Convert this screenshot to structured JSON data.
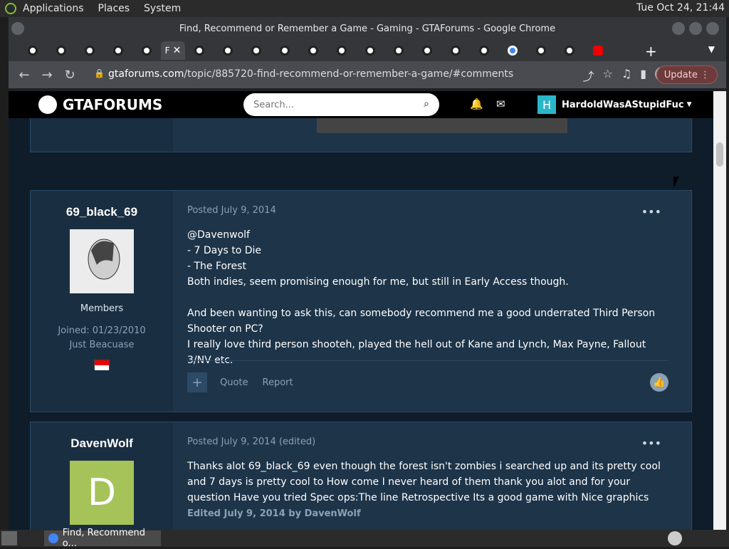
{
  "os_bar": {
    "menus": [
      "Applications",
      "Places",
      "System"
    ],
    "clock": "Tue Oct 24, 21:44"
  },
  "window": {
    "title": "Find, Recommend or Remember a Game - Gaming - GTAForums - Google Chrome"
  },
  "tabs": {
    "active_label": "F",
    "count": 22
  },
  "address": {
    "host": "gtaforums.com",
    "path": "/topic/885720-find-recommend-or-remember-a-game/#comments",
    "update_label": "Update"
  },
  "site": {
    "logo_text": "GTAFORUMS",
    "search_placeholder": "Search...",
    "username": "HardoldWasAStupidFuc",
    "user_initial": "H"
  },
  "posts": [
    {
      "author": "69_black_69",
      "role": "Members",
      "joined": "Joined: 01/23/2010",
      "location": "Just Beacuase",
      "date": "Posted July 9, 2014",
      "body_lines": [
        "@Davenwolf",
        "- 7 Days to Die",
        "- The Forest",
        "Both indies, seem promising enough for me, but still in Early Access though.",
        "",
        "And been wanting to ask this, can somebody recommend me a good underrated Third Person Shooter on PC?",
        "I really love third person shooteh, played the hell out of Kane and Lynch, Max Payne, Fallout 3/NV etc."
      ],
      "actions": [
        "Quote",
        "Report"
      ]
    },
    {
      "author": "DavenWolf",
      "avatar_initial": "D",
      "date": "Posted July 9, 2014 (edited)",
      "body": "Thanks alot 69_black_69 even though the forest isn't zombies i searched up and its pretty cool and 7 days is pretty cool to How come I never heard of them thank you alot and for your question Have you tried Spec ops:The line Retrospective Its a good game with Nice graphics",
      "edited": "Edited July 9, 2014 by DavenWolf"
    }
  ],
  "taskbar": {
    "item_label": "Find, Recommend o..."
  },
  "colors": {
    "post_bg": "#1d3449",
    "sidebar_bg": "#1a2e42",
    "page_bg": "#0f1c2a",
    "header_bg": "#000000"
  }
}
